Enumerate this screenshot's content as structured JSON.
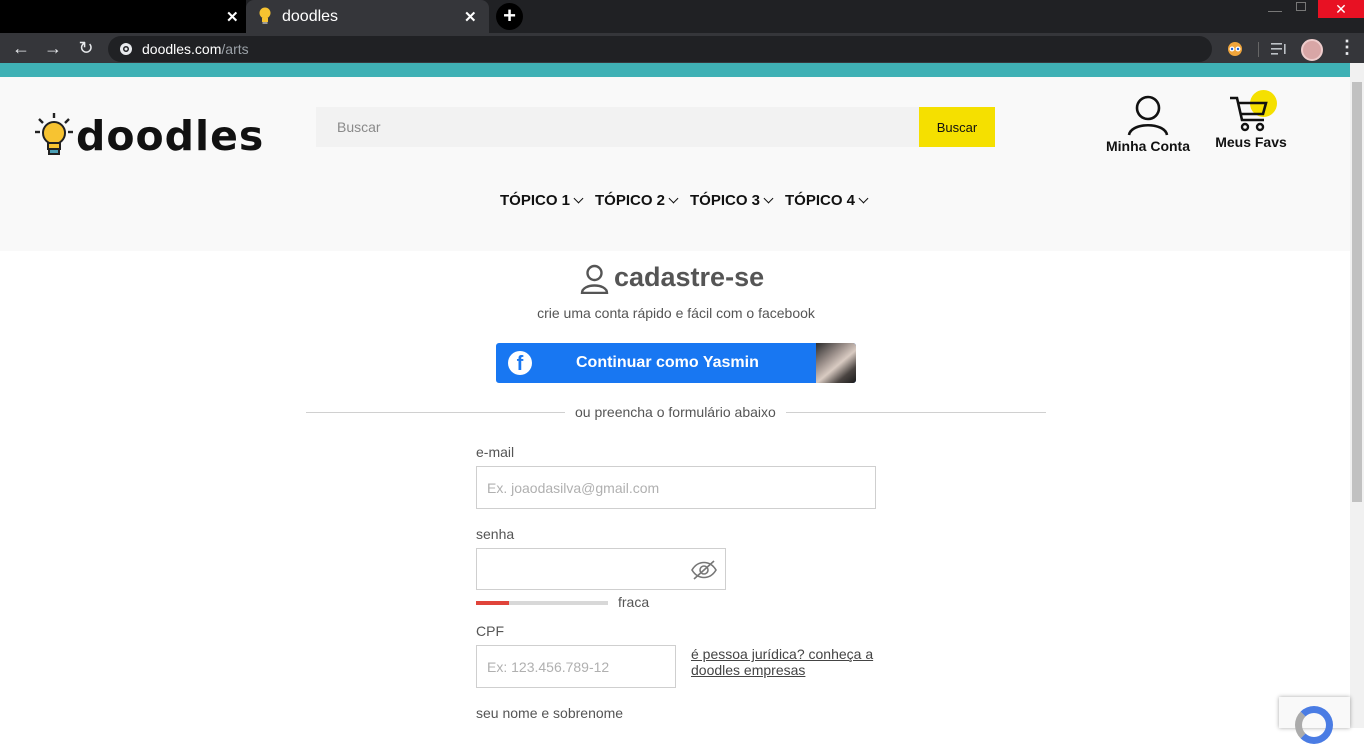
{
  "browser": {
    "tab_active_title": "doodles",
    "url_host": "doodles.com",
    "url_path": "/arts"
  },
  "header": {
    "logo_text": "doodles",
    "search_placeholder": "Buscar",
    "search_button": "Buscar",
    "account_label": "Minha Conta",
    "favs_label": "Meus Favs",
    "nav": [
      "TÓPICO 1",
      "TÓPICO 2",
      "TÓPICO 3",
      "TÓPICO 4"
    ]
  },
  "signup": {
    "title": "cadastre-se",
    "subtitle": "crie uma conta rápido e fácil com o facebook",
    "fb_button": "Continuar como Yasmin",
    "divider": "ou preencha o formulário abaixo",
    "email_label": "e-mail",
    "email_placeholder": "Ex. joaodasilva@gmail.com",
    "password_label": "senha",
    "password_strength": "fraca",
    "password_strength_level": 0.25,
    "cpf_label": "CPF",
    "cpf_placeholder": "Ex: 123.456.789-12",
    "pj_link": "é pessoa jurídica? conheça a doodles empresas",
    "name_label": "seu nome e sobrenome"
  },
  "colors": {
    "accent_bar": "#3fb1b5",
    "brand_yellow": "#f5e000",
    "facebook_blue": "#1877f2",
    "strength_weak": "#e0443a"
  },
  "icons": {
    "tab_favicon": "lightbulb-icon",
    "search": "search-icon",
    "account": "user-icon",
    "favs": "cart-icon",
    "password_toggle": "eye-off-icon",
    "facebook": "facebook-icon"
  }
}
